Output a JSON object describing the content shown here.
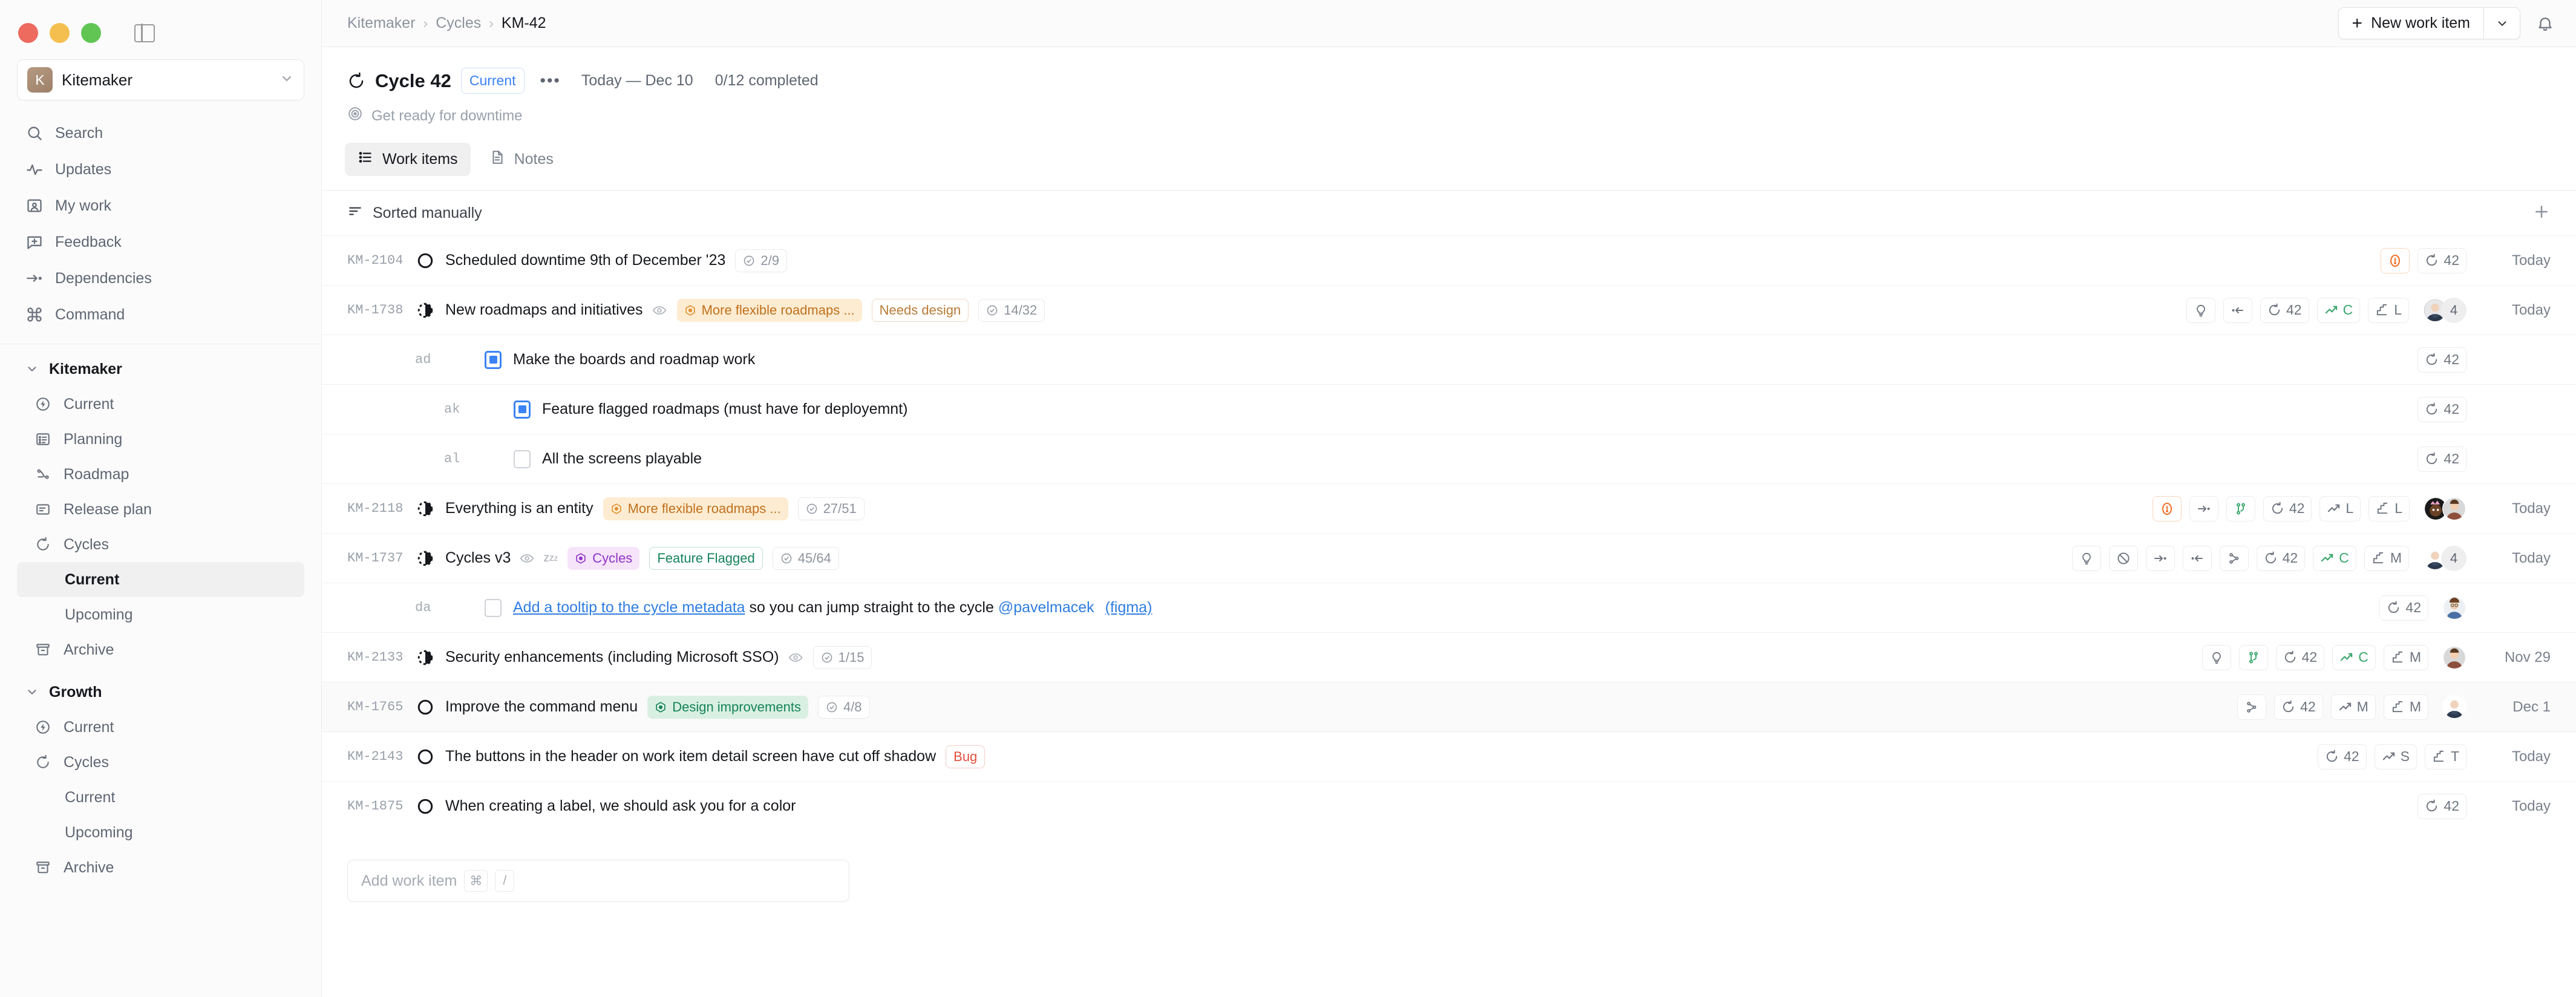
{
  "window": {
    "traffic_lights": [
      "close",
      "minimize",
      "zoom"
    ],
    "panel_toggle_icon": "sidebar-panel-icon"
  },
  "sidebar": {
    "workspace": {
      "initial": "K",
      "name": "Kitemaker",
      "chevron": "⌄"
    },
    "nav": [
      {
        "label": "Search",
        "icon": "search-icon"
      },
      {
        "label": "Updates",
        "icon": "activity-icon"
      },
      {
        "label": "My work",
        "icon": "user-card-icon"
      },
      {
        "label": "Feedback",
        "icon": "feedback-icon"
      },
      {
        "label": "Dependencies",
        "icon": "dependencies-icon"
      },
      {
        "label": "Command",
        "icon": "command-icon"
      }
    ],
    "groups": [
      {
        "label": "Kitemaker",
        "expanded": true,
        "items": [
          {
            "label": "Current",
            "icon": "bolt-circle-icon",
            "active": false,
            "indent": 1
          },
          {
            "label": "Planning",
            "icon": "planning-list-icon",
            "active": false,
            "indent": 1
          },
          {
            "label": "Roadmap",
            "icon": "roadmap-icon",
            "active": false,
            "indent": 1
          },
          {
            "label": "Release plan",
            "icon": "release-plan-icon",
            "active": false,
            "indent": 1
          },
          {
            "label": "Cycles",
            "icon": "cycle-icon",
            "active": false,
            "indent": 1
          },
          {
            "label": "Current",
            "icon": "none",
            "active": true,
            "indent": 2
          },
          {
            "label": "Upcoming",
            "icon": "none",
            "active": false,
            "indent": 2
          },
          {
            "label": "Archive",
            "icon": "archive-icon",
            "active": false,
            "indent": 1
          }
        ]
      },
      {
        "label": "Growth",
        "expanded": true,
        "items": [
          {
            "label": "Current",
            "icon": "bolt-circle-icon",
            "active": false,
            "indent": 1
          },
          {
            "label": "Cycles",
            "icon": "cycle-icon",
            "active": false,
            "indent": 1
          },
          {
            "label": "Current",
            "icon": "none",
            "active": false,
            "indent": 2
          },
          {
            "label": "Upcoming",
            "icon": "none",
            "active": false,
            "indent": 2
          },
          {
            "label": "Archive",
            "icon": "archive-icon",
            "active": false,
            "indent": 1
          }
        ]
      }
    ]
  },
  "topbar": {
    "breadcrumb": [
      {
        "label": "Kitemaker",
        "current": false
      },
      {
        "label": "Cycles",
        "current": false
      },
      {
        "label": "KM-42",
        "current": true
      }
    ],
    "separator": "›",
    "new_work_item_label": "New work item",
    "new_work_item_plus": "+",
    "new_work_item_caret": "⌄",
    "bell_icon": "notification-bell-icon"
  },
  "cycle": {
    "icon": "cycle-icon",
    "title": "Cycle 42",
    "status_badge": "Current",
    "more_menu": "•••",
    "date_range": "Today — Dec 10",
    "completed": "0/12 completed",
    "goal_icon": "target-icon",
    "goal": "Get ready for downtime"
  },
  "tabs": [
    {
      "label": "Work items",
      "icon": "list-icon",
      "active": true
    },
    {
      "label": "Notes",
      "icon": "document-icon",
      "active": false
    }
  ],
  "toolbar": {
    "sort_icon": "sort-icon",
    "sort_label": "Sorted manually",
    "add_icon": "plus-icon"
  },
  "colors": {
    "accent_blue": "#3b82f6",
    "link_blue": "#2f7de1",
    "amber_bg": "#fdecd2",
    "amber_fg": "#c1701b",
    "purple_bg": "#f6e4fa",
    "purple_fg": "#9333c6",
    "green_bg": "#d9efe2",
    "green_fg": "#14835a",
    "red_fg": "#e0513b",
    "orange_warn": "#f36c22",
    "green_icon": "#3aa76d"
  },
  "rows": [
    {
      "id": "KM-2104",
      "status": "todo",
      "title": "Scheduled downtime 9th of December '23",
      "watching": false,
      "labels": [],
      "progress": "2/9",
      "badges": [
        {
          "type": "warning",
          "icon": "alert-circle-icon",
          "text": ""
        },
        {
          "type": "cycle",
          "icon": "cycle-icon",
          "text": "42"
        }
      ],
      "avatars": [],
      "avatar_count": null,
      "date": "Today",
      "sub": false,
      "alt": false
    },
    {
      "id": "KM-1738",
      "status": "in-progress",
      "title": "New roadmaps and initiatives",
      "watching": true,
      "labels": [
        {
          "text": "More flexible roadmaps ...",
          "style": "space-amber",
          "icon": "space-hex-icon"
        },
        {
          "text": "Needs design",
          "style": "outline-orange",
          "icon": "none"
        }
      ],
      "progress": "14/32",
      "badges": [
        {
          "type": "idea",
          "icon": "lightbulb-icon",
          "text": ""
        },
        {
          "type": "depends-on",
          "icon": "depends-on-icon",
          "text": ""
        },
        {
          "type": "cycle",
          "icon": "cycle-icon",
          "text": "42"
        },
        {
          "type": "impact",
          "icon": "trend-up-icon",
          "text": "C",
          "color": "green"
        },
        {
          "type": "effort",
          "icon": "effort-steps-icon",
          "text": "L"
        }
      ],
      "avatars": [
        "avatar-bald-man"
      ],
      "avatar_count": "4",
      "date": "Today",
      "sub": false,
      "alt": false
    },
    {
      "id": "ad",
      "status": "checked",
      "title": "Make the boards and roadmap work",
      "watching": false,
      "labels": [],
      "progress": null,
      "badges": [
        {
          "type": "cycle",
          "icon": "cycle-icon",
          "text": "42"
        }
      ],
      "avatars": [],
      "avatar_count": null,
      "date": "",
      "sub": true,
      "indent": 1,
      "alt": false
    },
    {
      "id": "ak",
      "status": "checked",
      "title": "Feature flagged roadmaps (must have for deployemnt)",
      "watching": false,
      "labels": [],
      "progress": null,
      "badges": [
        {
          "type": "cycle",
          "icon": "cycle-icon",
          "text": "42"
        }
      ],
      "avatars": [],
      "avatar_count": null,
      "date": "",
      "sub": true,
      "indent": 2,
      "alt": false
    },
    {
      "id": "al",
      "status": "unchecked",
      "title": "All the screens playable",
      "watching": false,
      "labels": [],
      "progress": null,
      "badges": [
        {
          "type": "cycle",
          "icon": "cycle-icon",
          "text": "42"
        }
      ],
      "avatars": [],
      "avatar_count": null,
      "date": "",
      "sub": true,
      "indent": 2,
      "alt": false
    },
    {
      "id": "KM-2118",
      "status": "in-progress",
      "title": "Everything is an entity",
      "watching": false,
      "labels": [
        {
          "text": "More flexible roadmaps ...",
          "style": "space-amber",
          "icon": "space-hex-icon"
        }
      ],
      "progress": "27/51",
      "badges": [
        {
          "type": "warning",
          "icon": "alert-circle-icon",
          "text": ""
        },
        {
          "type": "dependency",
          "icon": "dependencies-icon",
          "text": ""
        },
        {
          "type": "branch",
          "icon": "git-branch-icon",
          "text": "",
          "color": "green"
        },
        {
          "type": "cycle",
          "icon": "cycle-icon",
          "text": "42"
        },
        {
          "type": "impact",
          "icon": "trend-up-icon",
          "text": "L"
        },
        {
          "type": "effort",
          "icon": "effort-steps-icon",
          "text": "L"
        }
      ],
      "avatars": [
        "avatar-party-person",
        "avatar-smiling-person"
      ],
      "avatar_count": null,
      "date": "Today",
      "sub": false,
      "alt": false
    },
    {
      "id": "KM-1737",
      "status": "in-progress",
      "title": "Cycles v3",
      "watching": true,
      "snoozed": true,
      "labels": [
        {
          "text": "Cycles",
          "style": "space-purple",
          "icon": "space-hex-icon"
        },
        {
          "text": "Feature Flagged",
          "style": "outline-teal",
          "icon": "none"
        }
      ],
      "progress": "45/64",
      "badges": [
        {
          "type": "idea",
          "icon": "lightbulb-icon",
          "text": ""
        },
        {
          "type": "blocked",
          "icon": "blocked-circle-icon",
          "text": ""
        },
        {
          "type": "dependency",
          "icon": "dependencies-icon",
          "text": ""
        },
        {
          "type": "depends-on",
          "icon": "depends-on-icon",
          "text": ""
        },
        {
          "type": "branch",
          "icon": "git-branch-icon",
          "text": ""
        },
        {
          "type": "cycle",
          "icon": "cycle-icon",
          "text": "42"
        },
        {
          "type": "impact",
          "icon": "trend-up-icon",
          "text": "C",
          "color": "green"
        },
        {
          "type": "effort",
          "icon": "effort-steps-icon",
          "text": "M"
        }
      ],
      "avatars": [
        "avatar-bald-man"
      ],
      "avatar_count": "4",
      "date": "Today",
      "sub": false,
      "alt": false
    },
    {
      "id": "da",
      "status": "unchecked",
      "title_link": "Add a tooltip to the cycle metadata",
      "title_rest": " so you can jump straight to the cycle ",
      "mention": "@pavelmacek",
      "attachment": "(figma)",
      "labels": [],
      "progress": null,
      "badges": [
        {
          "type": "cycle",
          "icon": "cycle-icon",
          "text": "42"
        }
      ],
      "avatars": [
        "avatar-glasses-person"
      ],
      "avatar_count": null,
      "date": "",
      "sub": true,
      "indent": 1,
      "alt": false
    },
    {
      "id": "KM-2133",
      "status": "in-progress",
      "title": "Security enhancements (including Microsoft SSO)",
      "watching": true,
      "labels": [],
      "progress": "1/15",
      "badges": [
        {
          "type": "idea",
          "icon": "lightbulb-icon",
          "text": ""
        },
        {
          "type": "branch",
          "icon": "git-branch-icon",
          "text": "",
          "color": "green"
        },
        {
          "type": "cycle",
          "icon": "cycle-icon",
          "text": "42"
        },
        {
          "type": "impact",
          "icon": "trend-up-icon",
          "text": "C",
          "color": "green"
        },
        {
          "type": "effort",
          "icon": "effort-steps-icon",
          "text": "M"
        }
      ],
      "avatars": [
        "avatar-smiling-person"
      ],
      "avatar_count": null,
      "date": "Nov 29",
      "sub": false,
      "alt": false
    },
    {
      "id": "KM-1765",
      "status": "todo",
      "title": "Improve the command menu",
      "watching": false,
      "labels": [
        {
          "text": "Design improvements",
          "style": "space-green",
          "icon": "space-hex-icon"
        }
      ],
      "progress": "4/8",
      "badges": [
        {
          "type": "branch",
          "icon": "git-branch-icon",
          "text": ""
        },
        {
          "type": "cycle",
          "icon": "cycle-icon",
          "text": "42"
        },
        {
          "type": "impact",
          "icon": "trend-up-icon",
          "text": "M"
        },
        {
          "type": "effort",
          "icon": "effort-steps-icon",
          "text": "M"
        }
      ],
      "avatars": [
        "avatar-bald-man"
      ],
      "avatar_count": null,
      "date": "Dec 1",
      "sub": false,
      "alt": true
    },
    {
      "id": "KM-2143",
      "status": "todo",
      "title": "The buttons in the header on work item detail screen have cut off shadow",
      "watching": false,
      "labels": [
        {
          "text": "Bug",
          "style": "outline-red",
          "icon": "none"
        }
      ],
      "progress": null,
      "badges": [
        {
          "type": "cycle",
          "icon": "cycle-icon",
          "text": "42"
        },
        {
          "type": "impact",
          "icon": "trend-up-icon",
          "text": "S"
        },
        {
          "type": "effort",
          "icon": "effort-steps-icon",
          "text": "T"
        }
      ],
      "avatars": [],
      "avatar_count": null,
      "date": "Today",
      "sub": false,
      "alt": false
    },
    {
      "id": "KM-1875",
      "status": "todo",
      "title": "When creating a label, we should ask you for a color",
      "watching": false,
      "labels": [],
      "progress": null,
      "badges": [
        {
          "type": "cycle",
          "icon": "cycle-icon",
          "text": "42"
        }
      ],
      "avatars": [],
      "avatar_count": null,
      "date": "Today",
      "sub": false,
      "alt": false
    }
  ],
  "add_work_item": {
    "placeholder": "Add work item",
    "kbd_1": "⌘",
    "kbd_2": "/"
  }
}
